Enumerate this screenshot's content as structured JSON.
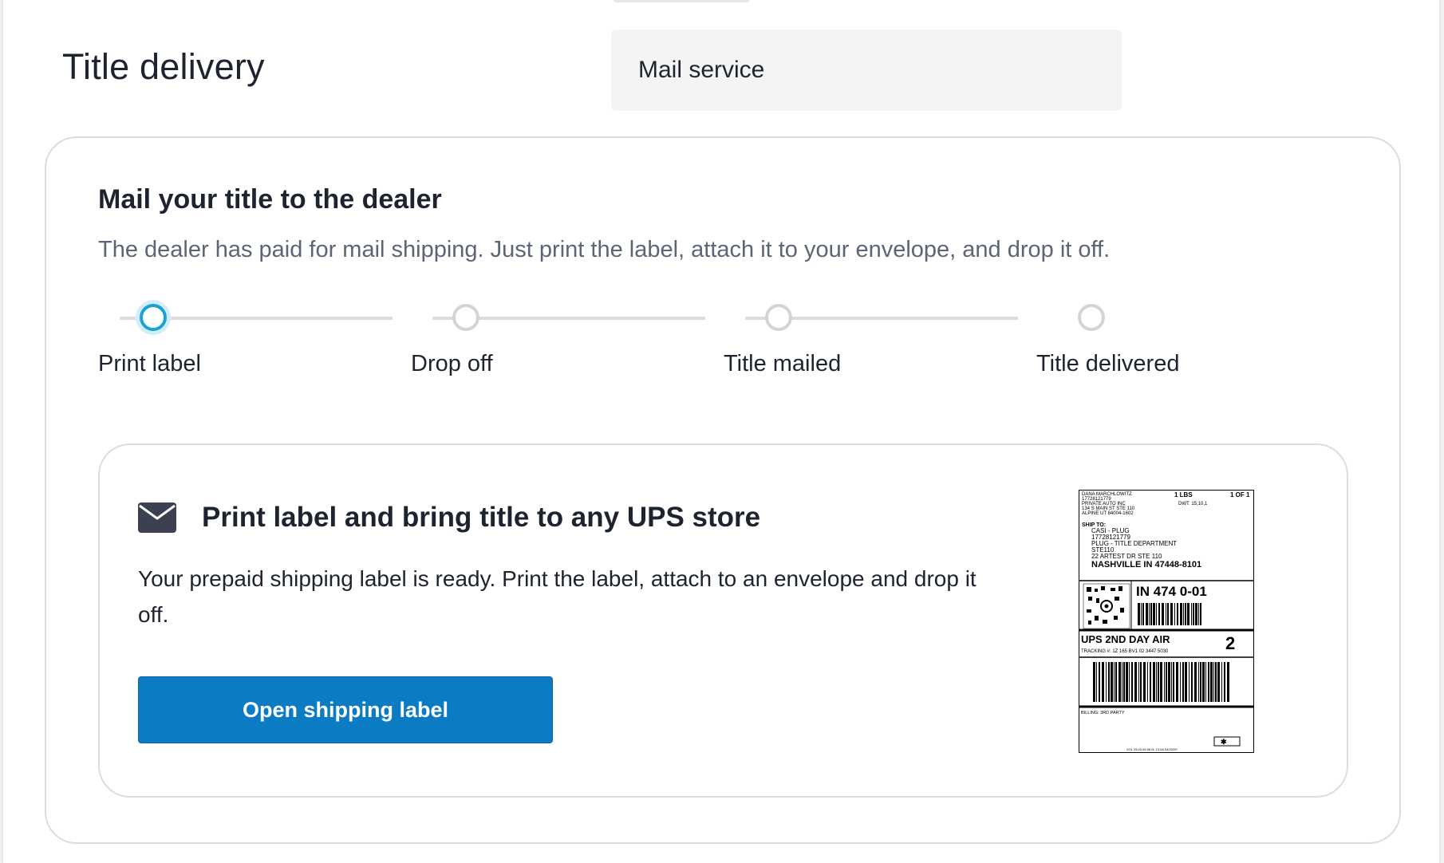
{
  "header": {
    "title": "Title delivery",
    "method_value": "Mail service"
  },
  "mail_card": {
    "heading": "Mail your title to the dealer",
    "description": "The dealer has paid for mail shipping. Just print the label, attach it to your envelope, and drop it off.",
    "steps": [
      {
        "label": "Print label",
        "active": true
      },
      {
        "label": "Drop off",
        "active": false
      },
      {
        "label": "Title mailed",
        "active": false
      },
      {
        "label": "Title delivered",
        "active": false
      }
    ]
  },
  "label_card": {
    "icon": "envelope-icon",
    "heading": "Print label and bring title to any UPS store",
    "description": "Your prepaid shipping label is ready. Print the label, attach to an envelope and drop it off.",
    "button_label": "Open shipping label"
  },
  "shipping_label_image": {
    "weight": "1 LBS",
    "count": "1 OF 1",
    "dwt": "DWT: 15,10,1",
    "sender_lines": [
      "DANA MARCHLOWITZ",
      "17728121779",
      "PRIVATE AUTO INC",
      "134 S MAIN ST STE 110",
      "ALPINE UT 84004-1602"
    ],
    "ship_to_label": "SHIP TO:",
    "recipient_lines": [
      "CASI - PLUG",
      "17728121779",
      "PLUG - TITLE DEPARTMENT",
      "STE110",
      "22 ARTEST DR STE 110"
    ],
    "city_line": "NASHVILLE IN 47448-8101",
    "routing": "IN 474 0-01",
    "service": "UPS 2ND DAY AIR",
    "service_number": "2",
    "tracking": "TRACKING #: 1Z 165 BV1 02 3447 5030",
    "billing": "BILLING: 3RD PARTY",
    "footer": "XOL 25.03.05        58.0L 13.0A 04/2025*"
  },
  "colors": {
    "accent": "#1aa3d1",
    "button": "#0b7bc4",
    "text": "#1e2330",
    "muted": "#5c6577"
  }
}
